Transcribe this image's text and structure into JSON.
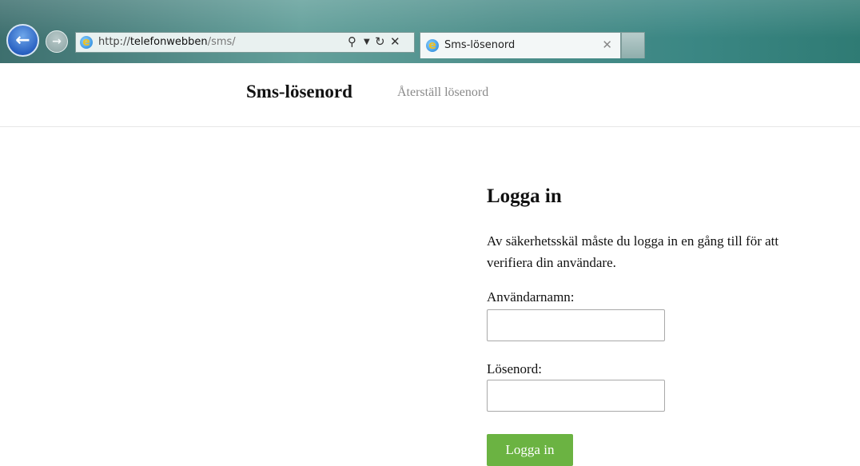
{
  "browser": {
    "url_scheme": "http://",
    "url_host": "telefonwebben",
    "url_path": "/sms/",
    "tab_title": "Sms-lösenord",
    "icons": {
      "back": "arrow-left-icon",
      "forward": "arrow-right-icon",
      "browser_logo": "ie-logo-icon",
      "search": "search-icon",
      "dropdown": "chevron-down-icon",
      "refresh": "refresh-icon",
      "stop": "close-icon",
      "tab_close": "close-icon"
    }
  },
  "header": {
    "brand": "Sms-lösenord",
    "nav_link": "Återställ lösenord"
  },
  "login": {
    "heading": "Logga in",
    "intro": "Av säkerhetsskäl måste du logga in en gång till för att verifiera din användare.",
    "username_label": "Användarnamn:",
    "username_value": "",
    "password_label": "Lösenord:",
    "password_value": "",
    "submit_label": "Logga in"
  },
  "colors": {
    "button_green": "#6bb342",
    "link_gray": "#8a8a8a",
    "chrome_teal": "#4c8e8a"
  }
}
